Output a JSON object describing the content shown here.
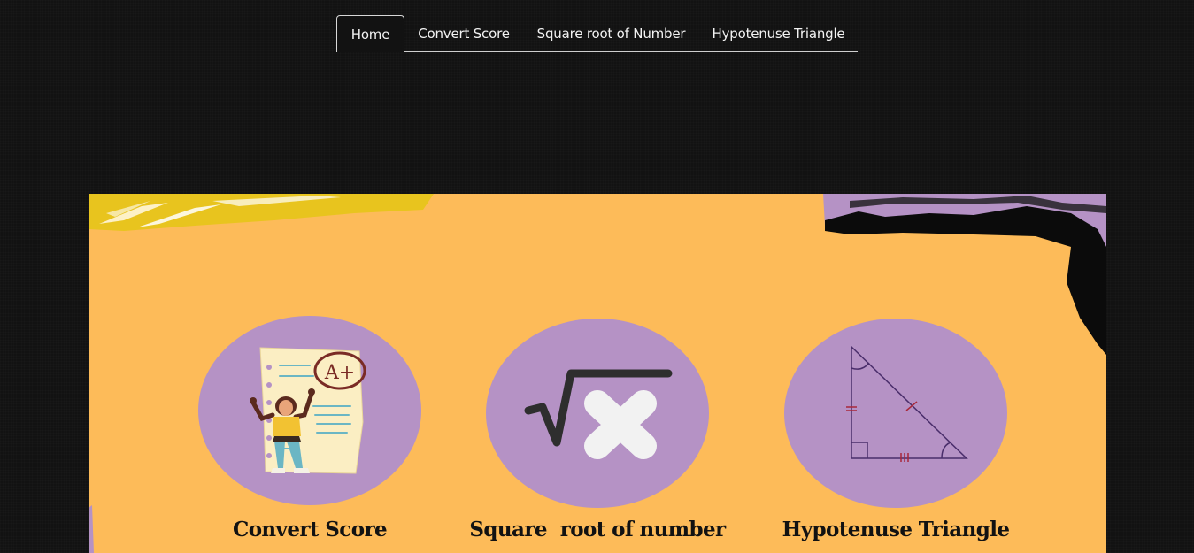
{
  "nav": {
    "items": [
      {
        "label": "Home",
        "active": true
      },
      {
        "label": "Convert Score",
        "active": false
      },
      {
        "label": "Square root of Number",
        "active": false
      },
      {
        "label": "Hypotenuse Triangle",
        "active": false
      }
    ]
  },
  "banner": {
    "background_color": "#fdbb59",
    "circle_color": "#b592c5",
    "cards": [
      {
        "title": "Convert Score",
        "icon": "graded-paper-student-icon"
      },
      {
        "title": "Square  root of number",
        "icon": "square-root-x-icon"
      },
      {
        "title": "Hypotenuse Triangle",
        "icon": "right-triangle-icon"
      }
    ],
    "grade_text": "A+"
  }
}
